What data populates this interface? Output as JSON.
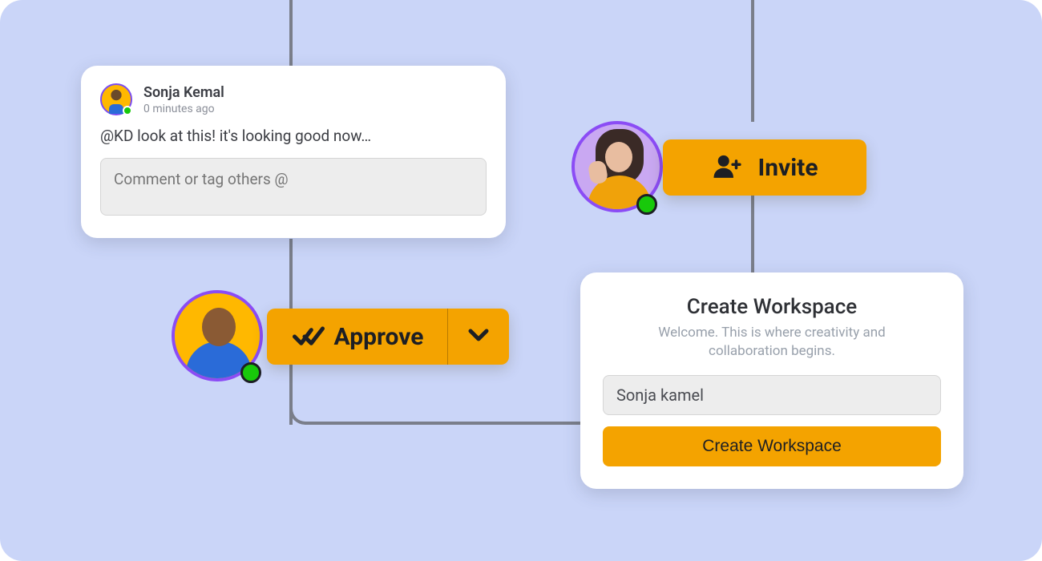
{
  "comment": {
    "author": "Sonja Kemal",
    "timestamp": "0 minutes ago",
    "body": "@KD look at this! it's looking good now…",
    "placeholder": "Comment or tag others @"
  },
  "approve": {
    "label": "Approve"
  },
  "invite": {
    "label": "Invite"
  },
  "workspace": {
    "title": "Create Workspace",
    "subtitle": "Welcome. This is where creativity and collaboration begins.",
    "input_value": "Sonja kamel",
    "button_label": "Create Workspace"
  },
  "colors": {
    "accent": "#f4a300",
    "presence": "#18c90b",
    "avatar_ring": "#8b4cf5",
    "background": "#cad5f8"
  }
}
